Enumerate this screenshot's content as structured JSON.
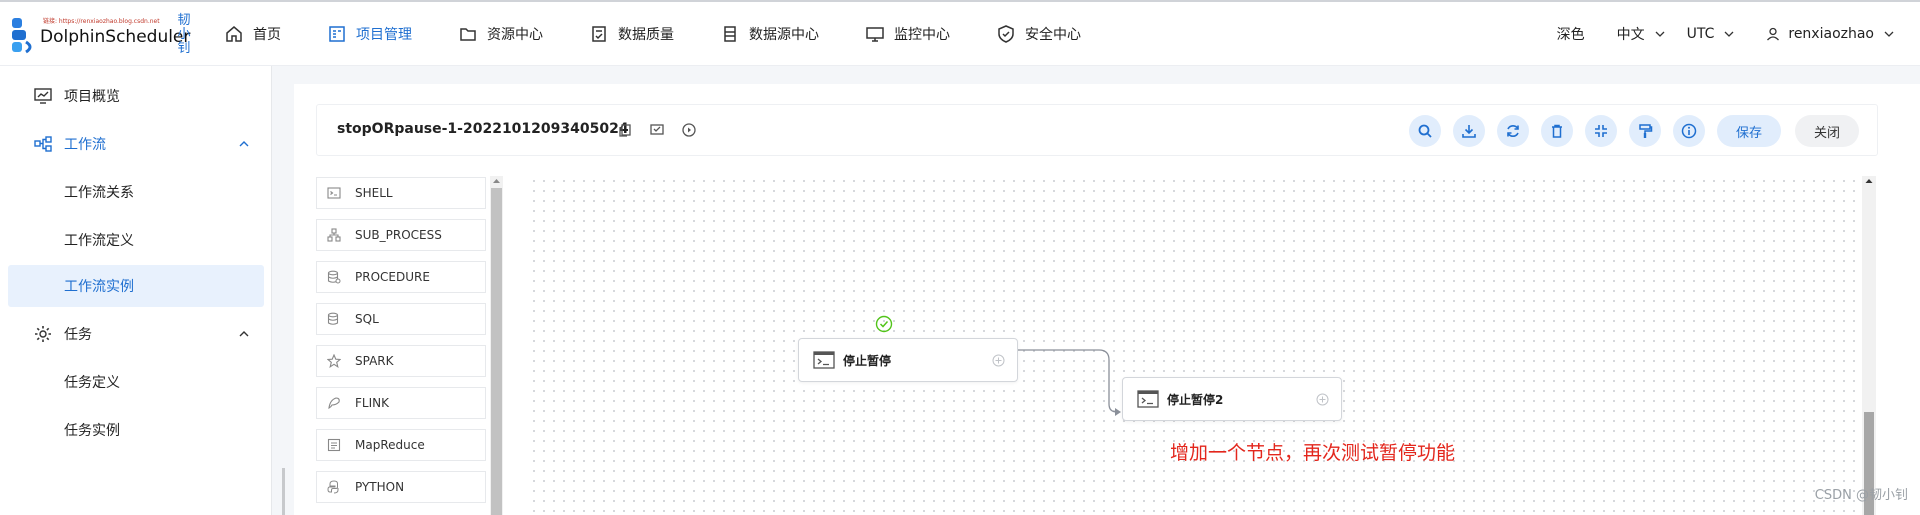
{
  "brand": {
    "name": "DolphinScheduler",
    "watermark_url": "链接: https://renxiaozhao.blog.csdn.net",
    "vertical_text": "韧小钊"
  },
  "nav": [
    {
      "label": "首页",
      "icon": "home-icon"
    },
    {
      "label": "项目管理",
      "icon": "project-icon",
      "active": true
    },
    {
      "label": "资源中心",
      "icon": "folder-icon"
    },
    {
      "label": "数据质量",
      "icon": "data-quality-icon"
    },
    {
      "label": "数据源中心",
      "icon": "datasource-icon"
    },
    {
      "label": "监控中心",
      "icon": "monitor-icon"
    },
    {
      "label": "安全中心",
      "icon": "shield-icon"
    }
  ],
  "header_right": {
    "theme": "深色",
    "language": "中文",
    "timezone": "UTC",
    "user": "renxiaozhao"
  },
  "sidebar": {
    "items": [
      {
        "label": "项目概览",
        "icon": "overview-icon"
      },
      {
        "label": "工作流",
        "icon": "workflow-icon",
        "expanded": true
      },
      {
        "label": "工作流关系"
      },
      {
        "label": "工作流定义"
      },
      {
        "label": "工作流实例",
        "selected": true
      },
      {
        "label": "任务",
        "icon": "gear-icon",
        "expanded": true
      },
      {
        "label": "任务定义"
      },
      {
        "label": "任务实例"
      }
    ]
  },
  "workflow": {
    "title": "stopORpause-1-20221012093405024",
    "save_label": "保存",
    "close_label": "关闭",
    "tools": [
      "search-icon",
      "download-icon",
      "refresh-icon",
      "delete-icon",
      "fullscreen-icon",
      "format-icon",
      "info-icon"
    ]
  },
  "palette": [
    {
      "label": "SHELL",
      "icon": "shell-icon"
    },
    {
      "label": "SUB_PROCESS",
      "icon": "sub-process-icon"
    },
    {
      "label": "PROCEDURE",
      "icon": "procedure-icon"
    },
    {
      "label": "SQL",
      "icon": "sql-icon"
    },
    {
      "label": "SPARK",
      "icon": "spark-icon"
    },
    {
      "label": "FLINK",
      "icon": "flink-icon"
    },
    {
      "label": "MapReduce",
      "icon": "mapreduce-icon"
    },
    {
      "label": "PYTHON",
      "icon": "python-icon"
    }
  ],
  "nodes": [
    {
      "label": "停止暂停",
      "status": "success"
    },
    {
      "label": "停止暂停2"
    }
  ],
  "annotation": "增加一个节点，再次测试暂停功能",
  "csdn_watermark": "CSDN @韧小钊",
  "colors": {
    "accent": "#1f6fd0",
    "accent_light": "#e1edfc",
    "annotation": "#e3261c",
    "success": "#52c41a"
  }
}
